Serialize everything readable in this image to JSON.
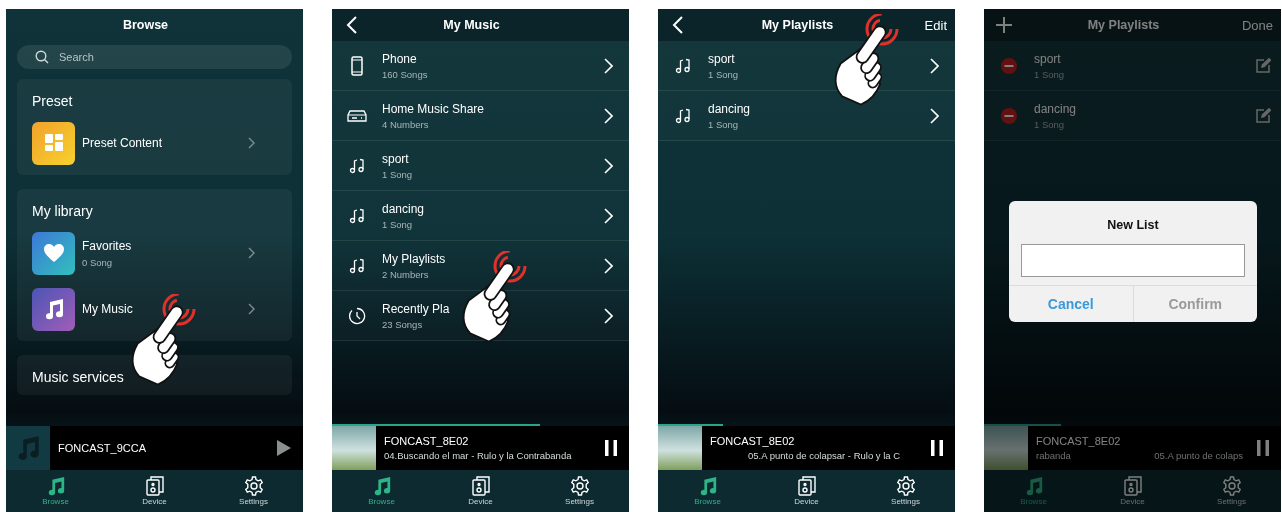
{
  "screens": [
    {
      "kind": "browse",
      "dimmed": false,
      "header": {
        "title": "Browse"
      },
      "search": {
        "placeholder": "Search"
      },
      "sections": [
        {
          "heading": "Preset",
          "items": [
            {
              "kind": "preset",
              "title": "Preset Content",
              "tapped": false
            }
          ]
        },
        {
          "heading": "My library",
          "items": [
            {
              "kind": "favorites",
              "title": "Favorites",
              "subtitle": "0  Song",
              "tapped": false
            },
            {
              "kind": "music",
              "title": "My Music",
              "tapped": true
            }
          ]
        },
        {
          "heading": "Music services"
        }
      ],
      "now_playing": {
        "artwork": {
          "kind": "note"
        },
        "title": "FONCAST_9CCA",
        "playing": false
      },
      "tabs": [
        {
          "kind": "browse",
          "label": "Browse",
          "selected": true
        },
        {
          "kind": "device",
          "label": "Device",
          "selected": false
        },
        {
          "kind": "settings",
          "label": "Settings",
          "selected": false
        }
      ]
    },
    {
      "kind": "list",
      "dimmed": false,
      "header": {
        "left": {
          "kind": "back"
        },
        "title": "My Music"
      },
      "rows": [
        {
          "kind": "phone",
          "title": "Phone",
          "subtitle": "160  Songs",
          "tapped": false
        },
        {
          "kind": "share",
          "title": "Home Music Share",
          "subtitle": "4 Numbers",
          "tapped": false
        },
        {
          "kind": "playlist",
          "title": "sport",
          "subtitle": "1  Song",
          "tapped": false
        },
        {
          "kind": "playlist",
          "title": "dancing",
          "subtitle": "1  Song",
          "tapped": false
        },
        {
          "kind": "playlist",
          "title": "My Playlists",
          "subtitle": "2 Numbers",
          "tapped": true
        },
        {
          "kind": "recent",
          "title": "Recently Pla",
          "subtitle": "23  Songs",
          "tapped": false
        }
      ],
      "now_playing": {
        "artwork": {
          "kind": "photo"
        },
        "title": "FONCAST_8E02",
        "subtitle": [
          "04.Buscando el mar - Rulo y la Contrabanda"
        ],
        "playing": true,
        "level": 0.7
      },
      "tabs": [
        {
          "kind": "browse",
          "label": "Browse",
          "selected": true
        },
        {
          "kind": "device",
          "label": "Device",
          "selected": false
        },
        {
          "kind": "settings",
          "label": "Settings",
          "selected": false
        }
      ]
    },
    {
      "kind": "list",
      "dimmed": false,
      "header": {
        "left": {
          "kind": "back"
        },
        "title": "My Playlists",
        "action": "Edit",
        "action_tapped": true
      },
      "rows": [
        {
          "kind": "playlist",
          "title": "sport",
          "subtitle": "1  Song",
          "tapped": false
        },
        {
          "kind": "playlist",
          "title": "dancing",
          "subtitle": "1  Song",
          "tapped": false
        }
      ],
      "now_playing": {
        "artwork": {
          "kind": "photo"
        },
        "title": "FONCAST_8E02",
        "subtitle": [
          "05.A punto de colapsar - Rulo y la C"
        ],
        "playing": true,
        "level": 0.22
      },
      "tabs": [
        {
          "kind": "browse",
          "label": "Browse",
          "selected": true
        },
        {
          "kind": "device",
          "label": "Device",
          "selected": false
        },
        {
          "kind": "settings",
          "label": "Settings",
          "selected": false
        }
      ]
    },
    {
      "kind": "list",
      "dimmed": true,
      "header": {
        "left": {
          "kind": "add"
        },
        "title": "My Playlists",
        "action": "Done"
      },
      "rows": [
        {
          "kind": "editable",
          "title": "sport",
          "subtitle": "1  Song",
          "tapped": false
        },
        {
          "kind": "editable",
          "title": "dancing",
          "subtitle": "1  Song",
          "tapped": false
        }
      ],
      "now_playing": {
        "artwork": {
          "kind": "photo"
        },
        "title": "FONCAST_8E02",
        "subtitle": [
          "rabanda",
          "05.A punto de colaps"
        ],
        "playing": true,
        "level": 0.26
      },
      "tabs": [
        {
          "kind": "browse",
          "label": "Browse",
          "selected": true
        },
        {
          "kind": "device",
          "label": "Device",
          "selected": false
        },
        {
          "kind": "settings",
          "label": "Settings",
          "selected": false
        }
      ],
      "dialog": {
        "title": "New List",
        "buttons": [
          {
            "label": "Cancel",
            "disabled": false
          },
          {
            "label": "Confirm",
            "disabled": true
          }
        ]
      }
    }
  ]
}
